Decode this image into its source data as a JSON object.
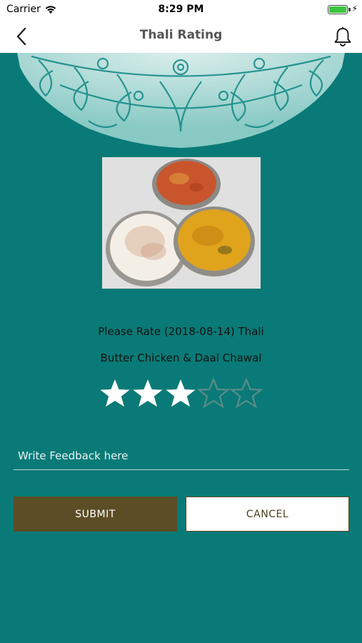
{
  "status_bar": {
    "carrier": "Carrier",
    "time": "8:29 PM"
  },
  "nav": {
    "title": "Thali Rating",
    "back_icon": "chevron-left-icon",
    "notify_icon": "bell-icon"
  },
  "photo": {
    "alt": "Thali photo"
  },
  "rating": {
    "prompt": "Please Rate (2018-08-14) Thali",
    "dish": "Butter Chicken & Daal Chawal",
    "value": 3,
    "max": 5
  },
  "feedback": {
    "placeholder": "Write Feedback here",
    "value": ""
  },
  "actions": {
    "submit_label": "SUBMIT",
    "cancel_label": "CANCEL"
  },
  "colors": {
    "background": "#097a77",
    "submit": "#5b4d25",
    "star_filled": "#ffffff"
  }
}
